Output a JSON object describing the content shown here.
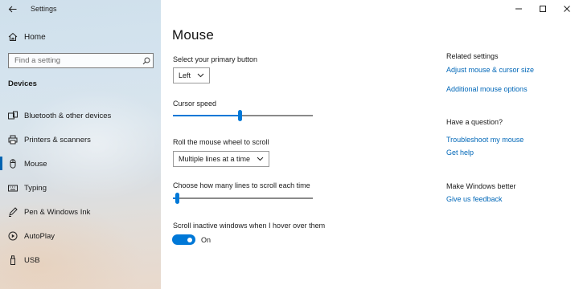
{
  "window": {
    "app_title": "Settings",
    "controls": [
      "minimize-icon",
      "maximize-icon",
      "close-icon"
    ]
  },
  "sidebar": {
    "home_label": "Home",
    "search_placeholder": "Find a setting",
    "section_title": "Devices",
    "items": [
      {
        "label": "Bluetooth & other devices",
        "icon": "bluetooth-icon",
        "active": false
      },
      {
        "label": "Printers & scanners",
        "icon": "printer-icon",
        "active": false
      },
      {
        "label": "Mouse",
        "icon": "mouse-icon",
        "active": true
      },
      {
        "label": "Typing",
        "icon": "keyboard-icon",
        "active": false
      },
      {
        "label": "Pen & Windows Ink",
        "icon": "pen-icon",
        "active": false
      },
      {
        "label": "AutoPlay",
        "icon": "autoplay-icon",
        "active": false
      },
      {
        "label": "USB",
        "icon": "usb-icon",
        "active": false
      }
    ]
  },
  "main": {
    "title": "Mouse",
    "primary_button": {
      "label": "Select your primary button",
      "value": "Left"
    },
    "cursor_speed": {
      "label": "Cursor speed",
      "level": 0.48
    },
    "scroll_mode": {
      "label": "Roll the mouse wheel to scroll",
      "value": "Multiple lines at a time"
    },
    "scroll_lines": {
      "label": "Choose how many lines to scroll each time",
      "level": 0.02
    },
    "inactive_scroll": {
      "label": "Scroll inactive windows when I hover over them",
      "state": "On"
    }
  },
  "related": {
    "related_title": "Related settings",
    "adjust_link": "Adjust mouse & cursor size",
    "additional_link": "Additional mouse options",
    "question_title": "Have a question?",
    "troubleshoot_link": "Troubleshoot my mouse",
    "help_link": "Get help",
    "better_title": "Make Windows better",
    "feedback_link": "Give us feedback"
  },
  "colors": {
    "accent": "#0078d7",
    "link": "#0067b8"
  }
}
